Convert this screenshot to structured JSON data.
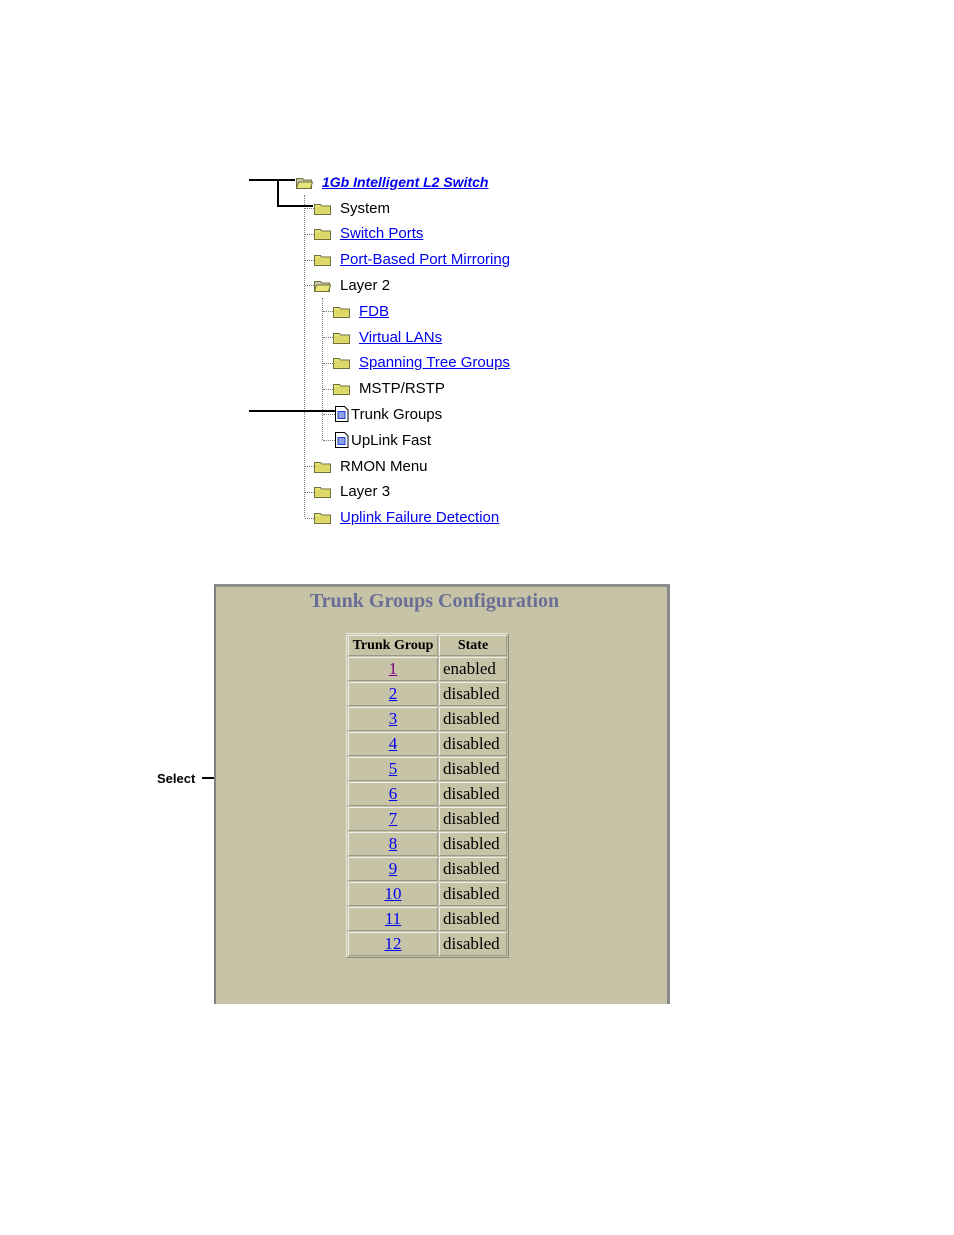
{
  "tree": {
    "root": {
      "label": "1Gb Intelligent L2 Switch",
      "icon": "folder-open-icon",
      "link": true
    },
    "items": [
      {
        "label": "System",
        "icon": "folder-icon",
        "link": false,
        "level": 1
      },
      {
        "label": "Switch Ports",
        "icon": "folder-icon",
        "link": true,
        "level": 1
      },
      {
        "label": "Port-Based Port Mirroring",
        "icon": "folder-icon",
        "link": true,
        "level": 1
      },
      {
        "label": "Layer 2",
        "icon": "folder-open-icon",
        "link": false,
        "level": 1
      },
      {
        "label": "FDB",
        "icon": "folder-icon",
        "link": true,
        "level": 2
      },
      {
        "label": "Virtual LANs",
        "icon": "folder-icon",
        "link": true,
        "level": 2
      },
      {
        "label": "Spanning Tree Groups",
        "icon": "folder-icon",
        "link": true,
        "level": 2
      },
      {
        "label": "MSTP/RSTP",
        "icon": "folder-icon",
        "link": false,
        "level": 2
      },
      {
        "label": "Trunk Groups",
        "icon": "document-icon",
        "link": false,
        "level": 2
      },
      {
        "label": "UpLink Fast",
        "icon": "document-icon",
        "link": false,
        "level": 2
      },
      {
        "label": "RMON Menu",
        "icon": "folder-icon",
        "link": false,
        "level": 1
      },
      {
        "label": "Layer 3",
        "icon": "folder-icon",
        "link": false,
        "level": 1
      },
      {
        "label": "Uplink Failure Detection",
        "icon": "folder-icon",
        "link": true,
        "level": 1
      }
    ]
  },
  "panel": {
    "title": "Trunk Groups Configuration",
    "columns": [
      "Trunk Group",
      "State"
    ],
    "rows": [
      {
        "group": "1",
        "state": "enabled",
        "visited": true
      },
      {
        "group": "2",
        "state": "disabled"
      },
      {
        "group": "3",
        "state": "disabled"
      },
      {
        "group": "4",
        "state": "disabled"
      },
      {
        "group": "5",
        "state": "disabled"
      },
      {
        "group": "6",
        "state": "disabled"
      },
      {
        "group": "7",
        "state": "disabled"
      },
      {
        "group": "8",
        "state": "disabled"
      },
      {
        "group": "9",
        "state": "disabled"
      },
      {
        "group": "10",
        "state": "disabled"
      },
      {
        "group": "11",
        "state": "disabled"
      },
      {
        "group": "12",
        "state": "disabled"
      }
    ]
  },
  "callouts": {
    "select_label": "Select"
  },
  "colors": {
    "link": "#0000ee",
    "visited_link": "#800080",
    "panel_bg": "#c7c3a6",
    "title": "#6a6e96"
  }
}
